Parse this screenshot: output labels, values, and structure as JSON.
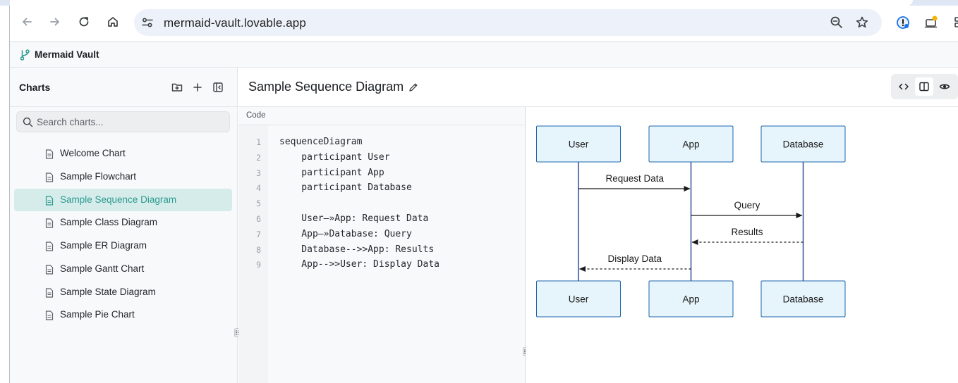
{
  "browser": {
    "url": "mermaid-vault.lovable.app",
    "icons": [
      "back-icon",
      "forward-icon",
      "reload-icon",
      "home-icon",
      "site-settings-icon",
      "zoom-icon",
      "bookmark-star-icon",
      "password-extension-icon",
      "notification-extension-icon"
    ]
  },
  "app": {
    "title": "Mermaid Vault",
    "accent_color": "#2b9a8e"
  },
  "sidebar": {
    "title": "Charts",
    "search_placeholder": "Search charts...",
    "items": [
      {
        "label": "Welcome Chart",
        "active": false
      },
      {
        "label": "Sample Flowchart",
        "active": false
      },
      {
        "label": "Sample Sequence Diagram",
        "active": true
      },
      {
        "label": "Sample Class Diagram",
        "active": false
      },
      {
        "label": "Sample ER Diagram",
        "active": false
      },
      {
        "label": "Sample Gantt Chart",
        "active": false
      },
      {
        "label": "Sample State Diagram",
        "active": false
      },
      {
        "label": "Sample Pie Chart",
        "active": false
      }
    ]
  },
  "editor": {
    "chart_title": "Sample Sequence Diagram",
    "code_label": "Code",
    "view_mode": "split",
    "lines": [
      {
        "num": "1",
        "text": "sequenceDiagram"
      },
      {
        "num": "2",
        "text": "    participant User"
      },
      {
        "num": "3",
        "text": "    participant App"
      },
      {
        "num": "4",
        "text": "    participant Database"
      },
      {
        "num": "5",
        "text": ""
      },
      {
        "num": "6",
        "text": "    User—»App: Request Data"
      },
      {
        "num": "7",
        "text": "    App—»Database: Query"
      },
      {
        "num": "8",
        "text": "    Database-->>App: Results"
      },
      {
        "num": "9",
        "text": "    App-->>User: Display Data"
      }
    ]
  },
  "diagram": {
    "participants": [
      "User",
      "App",
      "Database"
    ],
    "messages": [
      {
        "from": "User",
        "to": "App",
        "label": "Request Data",
        "style": "solid"
      },
      {
        "from": "App",
        "to": "Database",
        "label": "Query",
        "style": "solid"
      },
      {
        "from": "Database",
        "to": "App",
        "label": "Results",
        "style": "dashed"
      },
      {
        "from": "App",
        "to": "User",
        "label": "Display Data",
        "style": "dashed"
      }
    ],
    "colors": {
      "box_fill": "#e6f4fb",
      "box_stroke": "#1e66b0",
      "lifeline": "#1e3f8f",
      "arrow": "#1a1a1a"
    }
  }
}
